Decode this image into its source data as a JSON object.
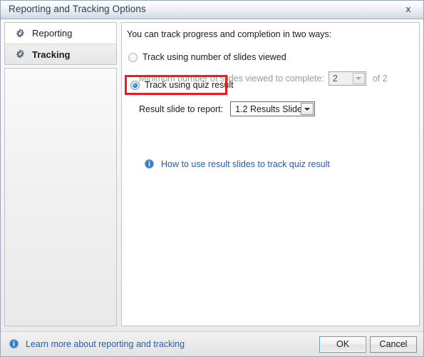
{
  "window": {
    "title": "Reporting and Tracking Options",
    "close_icon": "close-icon",
    "close_label": "x"
  },
  "sidebar": {
    "items": [
      {
        "label": "Reporting",
        "icon": "gear-icon",
        "selected": false
      },
      {
        "label": "Tracking",
        "icon": "gear-icon",
        "selected": true
      }
    ]
  },
  "main": {
    "intro": "You can track progress and completion in two ways:",
    "option_slides": {
      "label": "Track using number of slides viewed",
      "selected": false,
      "field_label": "Minimum number of slides viewed to complete:",
      "value": "2",
      "suffix": "of 2",
      "disabled": true
    },
    "option_quiz": {
      "label": "Track using quiz result",
      "selected": true,
      "highlighted": true,
      "field_label": "Result slide to report:",
      "value": "1.2 Results Slide"
    },
    "help_link": {
      "text": "How to use result slides to track quiz result",
      "icon": "info-icon"
    }
  },
  "footer": {
    "learn_more": {
      "text": "Learn more about reporting and tracking",
      "icon": "info-icon"
    },
    "ok_label": "OK",
    "cancel_label": "Cancel"
  },
  "colors": {
    "accent_blue": "#1d5fb8",
    "highlight_red": "#ec1c24",
    "radio_blue": "#1a7fc4",
    "focus_border": "#4aa8e0"
  }
}
